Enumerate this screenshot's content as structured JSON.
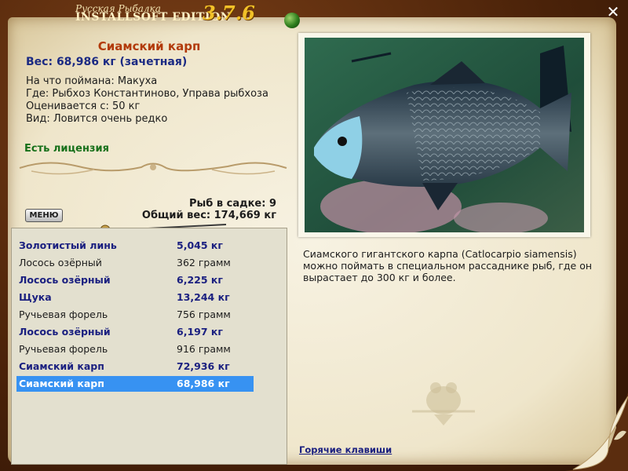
{
  "header": {
    "subtitle": "Русская Рыбалка",
    "edition": "INSTALLSOFT EDITION",
    "version": "3.7.6"
  },
  "fish": {
    "name": "Сиамский карп",
    "weight": "Вес: 68,986 кг (зачетная)",
    "bait": "На что поймана: Макуха",
    "location": "Где: Рыбхоз Константиново, Управа рыбхоза",
    "rated_from": "Оценивается с: 50 кг",
    "species_note": "Вид: Ловится очень редко",
    "license": "Есть лицензия",
    "description": "Сиамского гигантского карпа (Catlocarpio siamensis) можно поймать в специальном рассаднике рыб, где он вырастает до 300 кг и более."
  },
  "sadok": {
    "count": "Рыб в садке: 9",
    "total": "Общий вес: 174,669 кг"
  },
  "menu_label": "МЕНЮ",
  "catch_list": [
    {
      "name": "Золотистый линь",
      "weight": "5,045 кг",
      "highlight": true
    },
    {
      "name": "Лосось озёрный",
      "weight": "362 грамм",
      "highlight": false
    },
    {
      "name": "Лосось озёрный",
      "weight": "6,225 кг",
      "highlight": true
    },
    {
      "name": "Щука",
      "weight": "13,244 кг",
      "highlight": true
    },
    {
      "name": "Ручьевая форель",
      "weight": "756 грамм",
      "highlight": false
    },
    {
      "name": "Лосось озёрный",
      "weight": "6,197 кг",
      "highlight": true
    },
    {
      "name": "Ручьевая форель",
      "weight": "916 грамм",
      "highlight": false
    },
    {
      "name": "Сиамский карп",
      "weight": "72,936 кг",
      "highlight": true
    },
    {
      "name": "Сиамский карп",
      "weight": "68,986 кг",
      "highlight": true,
      "selected": true
    }
  ],
  "hotkeys_label": "Горячие клавиши",
  "colors": {
    "fish_name": "#b23a0a",
    "weight": "#1b2a83",
    "license": "#17701a",
    "selection": "#3792f2",
    "version": "#f2c128"
  }
}
